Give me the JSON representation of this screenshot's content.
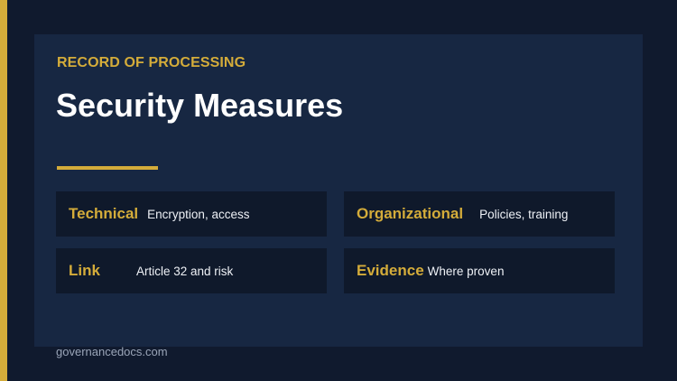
{
  "header": {
    "eyebrow": "RECORD OF PROCESSING",
    "title": "Security Measures"
  },
  "cards": [
    {
      "label": "Technical",
      "description": "Encryption, access"
    },
    {
      "label": "Organizational",
      "description": "Policies, training"
    },
    {
      "label": "Link",
      "description": "Article 32 and risk"
    },
    {
      "label": "Evidence",
      "description": "Where proven"
    }
  ],
  "footer": {
    "domain": "governancedocs.com"
  },
  "colors": {
    "background": "#101a2e",
    "panel": "#172742",
    "card": "#0f192b",
    "accent": "#d4ac3a",
    "title_text": "#ffffff",
    "body_text": "#eef1f6",
    "muted_text": "#9aa5b8"
  }
}
